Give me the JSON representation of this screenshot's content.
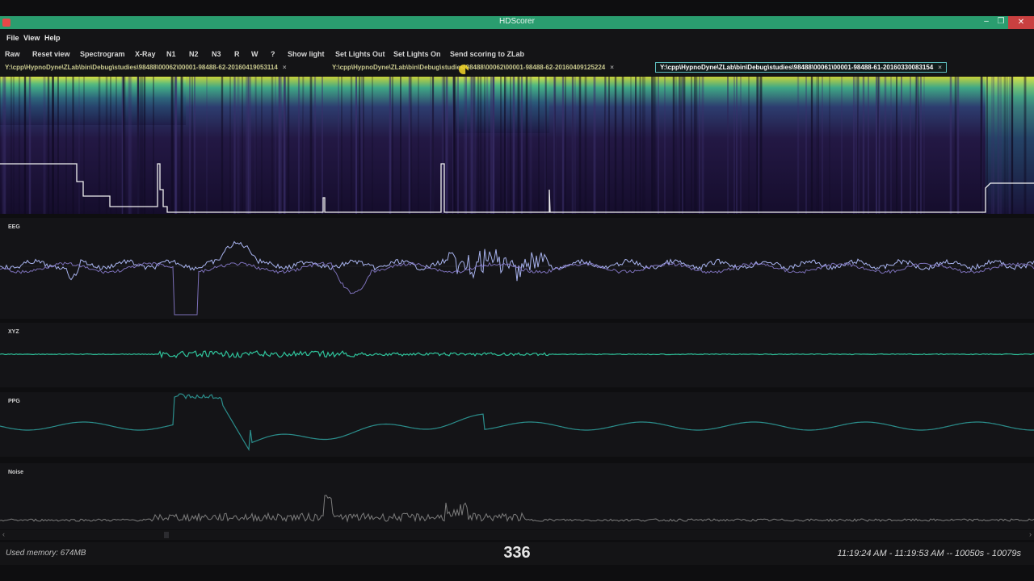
{
  "window": {
    "title": "HDScorer",
    "minimize": "–",
    "maximize": "❐",
    "close": "✕"
  },
  "menu": [
    "File",
    "View",
    "Help"
  ],
  "toolbar": [
    "Raw",
    "Reset view",
    "Spectrogram",
    "X-Ray",
    "N1",
    "N2",
    "N3",
    "R",
    "W",
    "?",
    "Show light",
    "Set Lights Out",
    "Set Lights On",
    "Send scoring to ZLab"
  ],
  "tabs": [
    {
      "label": "Y:\\cpp\\HypnoDyne\\ZLab\\bin\\Debug\\studies\\98488\\00062\\00001-98488-62-20160419053114",
      "close": "×",
      "active": false
    },
    {
      "label": "Y:\\cpp\\HypnoDyne\\ZLab\\bin\\Debug\\studies\\98488\\00062\\00001-98488-62-20160409125224",
      "close": "×",
      "active": false
    },
    {
      "label": "Y:\\cpp\\HypnoDyne\\ZLab\\bin\\Debug\\studies\\98488\\00061\\00001-98488-61-20160330083154",
      "close": "×",
      "active": true
    }
  ],
  "panels": {
    "eeg": "EEG",
    "xyz": "XYZ",
    "ppg": "PPG",
    "noise": "Noise"
  },
  "scroll": {
    "left": "‹",
    "right": "›"
  },
  "status": {
    "memory": "Used memory: 674MB",
    "epoch": "336",
    "time_range": "11:19:24 AM - 11:19:53 AM -- 10050s - 10079s"
  },
  "colors": {
    "titlebar": "#2a9d6f",
    "spectrogram_low": "#1b1340",
    "spectrogram_high": "#c8d23a",
    "eeg_trace": "#a9b4f0",
    "xyz_trace": "#2fc49c",
    "ppg_trace": "#2b8e8c",
    "noise_trace": "#7c7c7c"
  }
}
